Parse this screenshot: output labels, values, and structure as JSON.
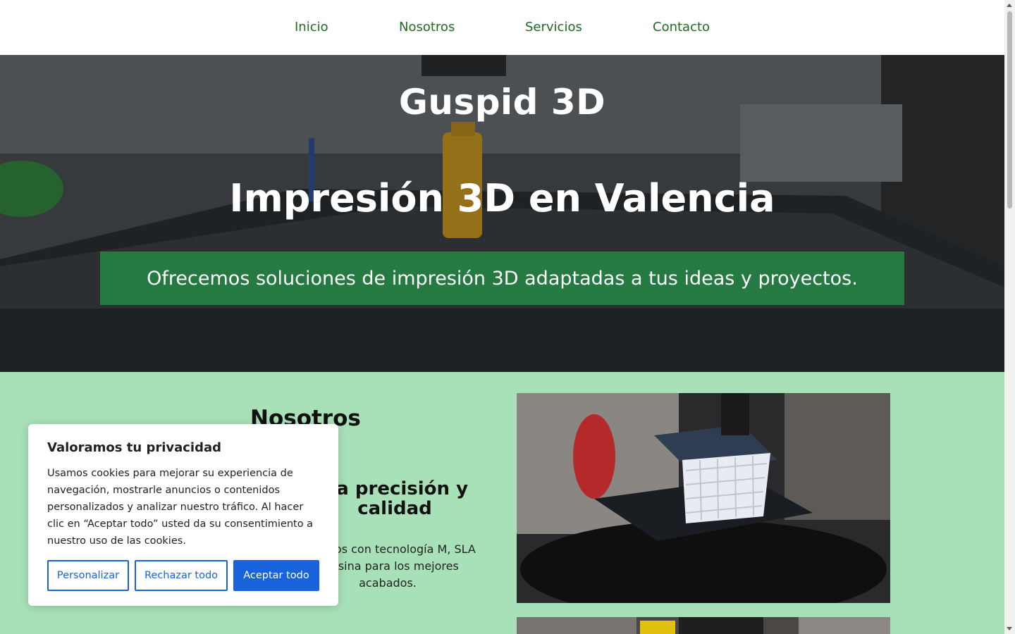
{
  "nav": {
    "items": [
      {
        "label": "Inicio"
      },
      {
        "label": "Nosotros"
      },
      {
        "label": "Servicios"
      },
      {
        "label": "Contacto"
      }
    ]
  },
  "hero": {
    "title": "Guspid 3D",
    "subtitle": "Impresión 3D en Valencia",
    "banner": "Ofrecemos soluciones de impresión 3D adaptadas a tus ideas y proyectos."
  },
  "about": {
    "heading": "Nosotros",
    "subheading": "lta precisión y calidad",
    "text": "pajamos con tecnología M, SLA y resina para los mejores acabados."
  },
  "cookie": {
    "title": "Valoramos tu privacidad",
    "body": "Usamos cookies para mejorar su experiencia de navegación, mostrarle anuncios o contenidos personalizados y analizar nuestro tráfico. Al hacer clic en “Aceptar todo” usted da su consentimiento a nuestro uso de las cookies.",
    "customize_label": "Personalizar",
    "reject_label": "Rechazar todo",
    "accept_label": "Aceptar todo"
  },
  "colors": {
    "nav_link": "#1f6b1f",
    "banner": "#228b46",
    "about_bg": "#a8e1b8",
    "cookie_accent": "#1863dc"
  }
}
